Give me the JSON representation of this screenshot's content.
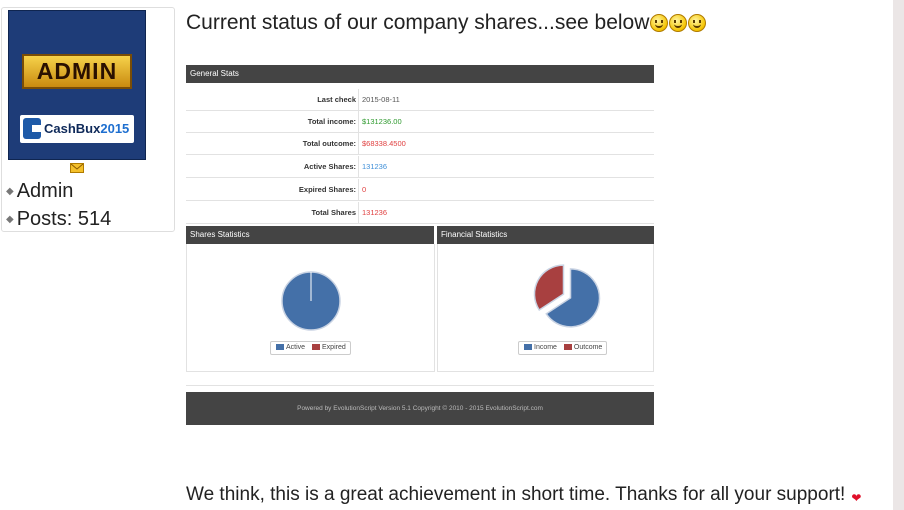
{
  "author": {
    "avatar_rank": "ADMIN",
    "avatar_brand_prefix": "CashBux",
    "avatar_brand_suffix": "2015",
    "role": "Admin",
    "posts_text": "Posts: 514"
  },
  "post": {
    "heading": "Current status of our company shares...see below",
    "closing": "We think, this is a great achievement in short time. Thanks for all your support!"
  },
  "embed": {
    "general_title": "General Stats",
    "stats": [
      {
        "label": "Last check",
        "value": "2015-08-11"
      },
      {
        "label": "Total income:",
        "value": "$131236.00"
      },
      {
        "label": "Total outcome:",
        "value": "$68338.4500"
      },
      {
        "label": "Active Shares:",
        "value": "131236"
      },
      {
        "label": "Expired Shares:",
        "value": "0"
      },
      {
        "label": "Total Shares",
        "value": "131236"
      }
    ],
    "shares_title": "Shares Statistics",
    "financial_title": "Financial Statistics",
    "shares_legend": [
      "Active",
      "Expired"
    ],
    "financial_legend": [
      "Income",
      "Outcome"
    ],
    "footer": "Powered by EvolutionScript Version 5.1 Copyright © 2010 - 2015 EvolutionScript.com"
  },
  "colors": {
    "income_green": "#2e9a2e",
    "outcome_red": "#e04040",
    "active_blue": "#3f8fd8",
    "pie_blue": "#4470a8",
    "pie_red": "#a84040"
  },
  "chart_data": [
    {
      "type": "pie",
      "title": "Shares Statistics",
      "categories": [
        "Active",
        "Expired"
      ],
      "values": [
        131236,
        0
      ]
    },
    {
      "type": "pie",
      "title": "Financial Statistics",
      "categories": [
        "Income",
        "Outcome"
      ],
      "values": [
        131236.0,
        68338.45
      ]
    }
  ]
}
